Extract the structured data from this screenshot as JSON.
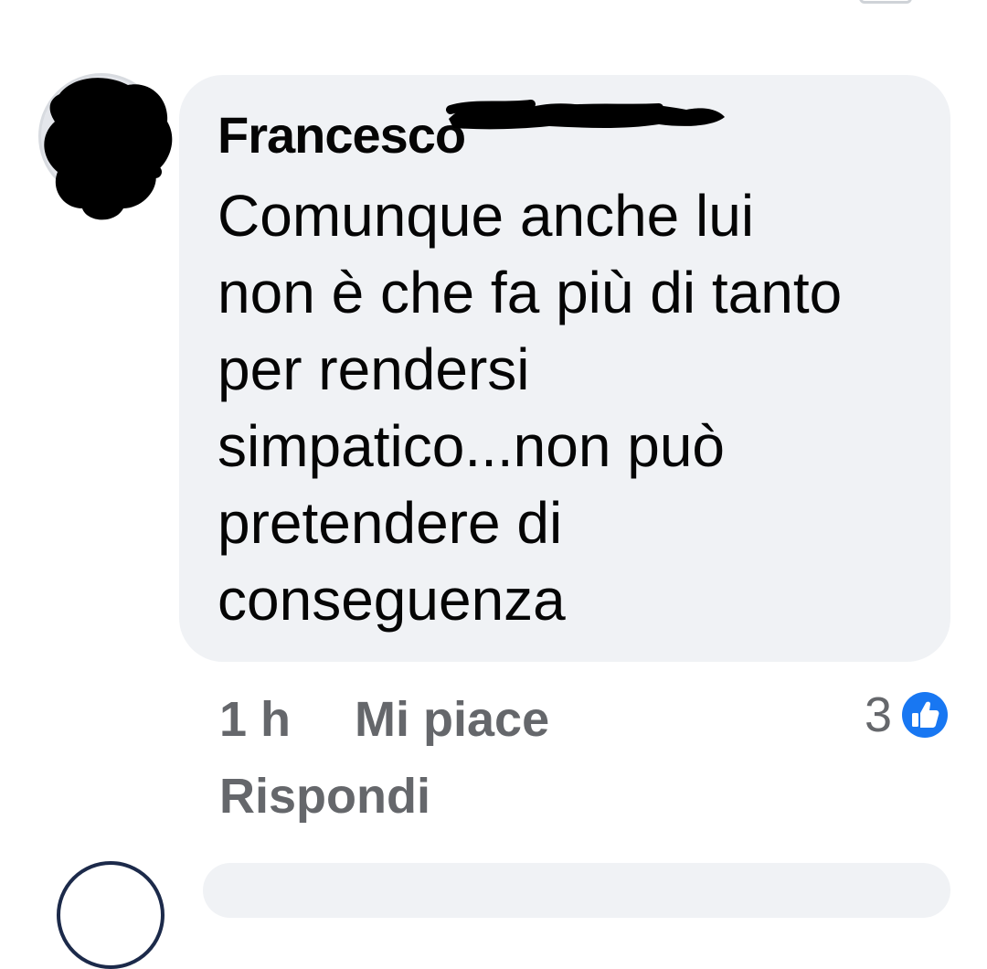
{
  "comment": {
    "author": "Francesco",
    "text": "Comunque anche lui\nnon è che fa più di tanto\nper rendersi\nsimpatico...non può\npretendere di\nconseguenza",
    "time": "1 h",
    "like_label": "Mi piace",
    "reply_label": "Rispondi",
    "reaction_count": "3",
    "reaction_icon": "like-thumb-icon"
  },
  "colors": {
    "bubble_bg": "#f0f2f5",
    "text": "#050505",
    "meta_text": "#65676b",
    "like_blue": "#1877f2"
  }
}
